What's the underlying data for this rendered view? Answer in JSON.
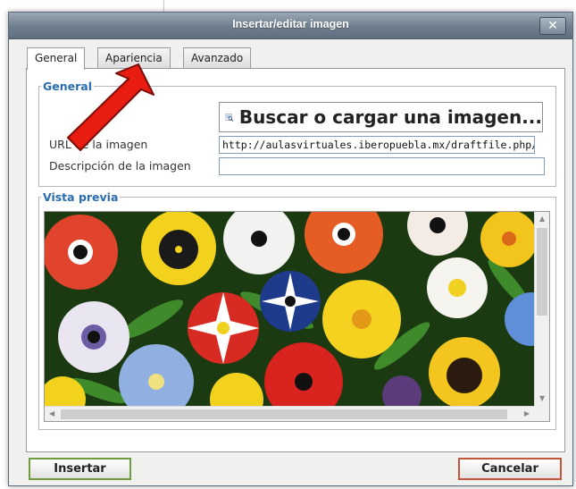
{
  "dialog": {
    "title": "Insertar/editar imagen",
    "close_label": "✕"
  },
  "tabs": [
    {
      "label": "General",
      "active": true
    },
    {
      "label": "Apariencia",
      "active": false
    },
    {
      "label": "Avanzado",
      "active": false
    }
  ],
  "general": {
    "legend": "General",
    "browse_button": "Buscar o cargar una imagen...",
    "url_label": "URL de la imagen",
    "url_value": "http://aulasvirtuales.iberopuebla.mx/draftfile.php/",
    "description_label": "Descripción de la imagen",
    "description_value": ""
  },
  "preview": {
    "legend": "Vista previa"
  },
  "footer": {
    "insert_label": "Insertar",
    "cancel_label": "Cancelar"
  },
  "colors": {
    "legend_blue": "#2b6cb0",
    "insert_border": "#6f9c3e",
    "cancel_border": "#c4563c",
    "annotation_arrow": "#e81c10"
  },
  "icons": {
    "browse": "image-search-icon",
    "annotation": "red-pointer-arrow"
  }
}
